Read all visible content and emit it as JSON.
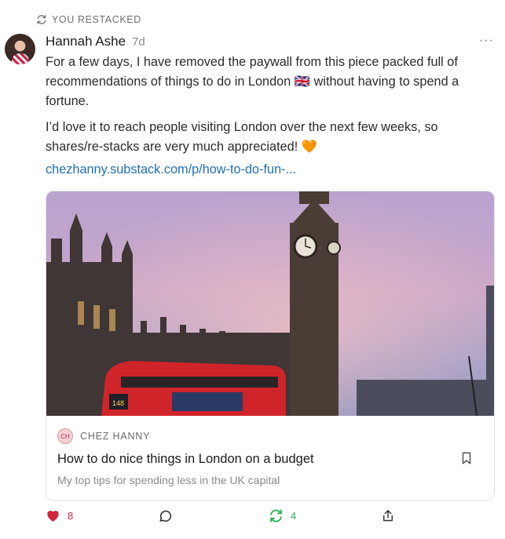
{
  "restack_banner": {
    "label": "YOU RESTACKED",
    "icon": "restack-icon"
  },
  "post": {
    "author": "Hannah Ashe",
    "age": "7d",
    "paragraphs": [
      "For a few days, I have removed the paywall from this piece packed full of recommendations of things to do in London 🇬🇧 without having to spend a fortune.",
      "I’d love it to reach people visiting London over the next few weeks, so shares/re-stacks are very much appreciated! 🧡"
    ],
    "link_text": "chezhanny.substack.com/p/how-to-do-fun-...",
    "more_label": "···"
  },
  "card": {
    "publication": "CHEZ HANNY",
    "publication_initials": "CH",
    "title": "How to do nice things in London on a budget",
    "subtitle": "My top tips for spending less in the UK capital",
    "bus_route": "148"
  },
  "actions": {
    "likes": "8",
    "restacks": "4"
  },
  "colors": {
    "like": "#d0273f",
    "restack": "#2bb152",
    "link": "#1f6fb5"
  }
}
